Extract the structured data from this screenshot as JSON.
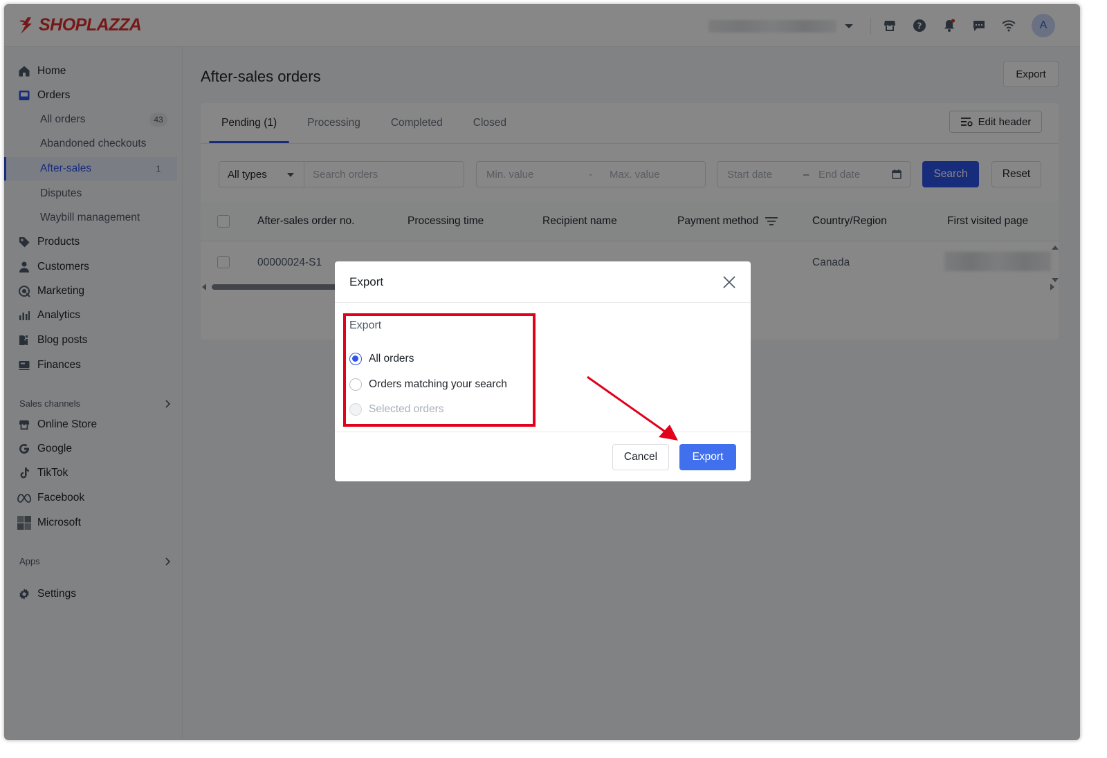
{
  "brand": {
    "name": "SHOPLAZZA",
    "color": "#e02f2f"
  },
  "colors": {
    "primary": "#2f54eb",
    "highlight": "#e2001a"
  },
  "topbar": {
    "icons": [
      "store-icon",
      "help-icon",
      "bell-icon",
      "message-icon",
      "wifi-icon"
    ],
    "avatar_letter": "A"
  },
  "sidebar": {
    "items": [
      {
        "label": "Home",
        "icon": "home-icon"
      },
      {
        "label": "Orders",
        "icon": "orders-icon"
      },
      {
        "label": "Products",
        "icon": "tag-icon"
      },
      {
        "label": "Customers",
        "icon": "person-icon"
      },
      {
        "label": "Marketing",
        "icon": "marketing-icon"
      },
      {
        "label": "Analytics",
        "icon": "bar-chart-icon"
      },
      {
        "label": "Blog posts",
        "icon": "blog-icon"
      },
      {
        "label": "Finances",
        "icon": "finance-icon"
      }
    ],
    "order_subitems": [
      {
        "label": "All orders",
        "count": "43"
      },
      {
        "label": "Abandoned checkouts",
        "count": ""
      },
      {
        "label": "After-sales",
        "count": "1"
      },
      {
        "label": "Disputes",
        "count": ""
      },
      {
        "label": "Waybill management",
        "count": ""
      }
    ],
    "sales_channels_label": "Sales channels",
    "channels": [
      {
        "label": "Online Store",
        "icon": "store-icon"
      },
      {
        "label": "Google",
        "icon": "google-icon"
      },
      {
        "label": "TikTok",
        "icon": "tiktok-icon"
      },
      {
        "label": "Facebook",
        "icon": "meta-icon"
      },
      {
        "label": "Microsoft",
        "icon": "microsoft-icon"
      }
    ],
    "apps_label": "Apps",
    "settings_label": "Settings"
  },
  "page": {
    "title": "After-sales orders",
    "export_label": "Export",
    "tabs": [
      "Pending (1)",
      "Processing",
      "Completed",
      "Closed"
    ],
    "edit_header_label": "Edit header"
  },
  "filters": {
    "type_value": "All types",
    "search_placeholder": "Search orders",
    "min_placeholder": "Min. value",
    "range_sep": "-",
    "max_placeholder": "Max. value",
    "start_placeholder": "Start date",
    "date_sep": "–",
    "end_placeholder": "End date",
    "search_label": "Search",
    "reset_label": "Reset"
  },
  "table": {
    "columns": [
      "After-sales order no.",
      "Processing time",
      "Recipient name",
      "Payment method",
      "Country/Region",
      "First visited page"
    ],
    "rows": [
      {
        "order_no": "00000024-S1",
        "country": "Canada"
      }
    ]
  },
  "modal": {
    "title": "Export",
    "group_label": "Export",
    "options": [
      {
        "label": "All orders",
        "checked": true,
        "disabled": false
      },
      {
        "label": "Orders matching your search",
        "checked": false,
        "disabled": false
      },
      {
        "label": "Selected orders",
        "checked": false,
        "disabled": true
      }
    ],
    "cancel_label": "Cancel",
    "export_label": "Export"
  }
}
